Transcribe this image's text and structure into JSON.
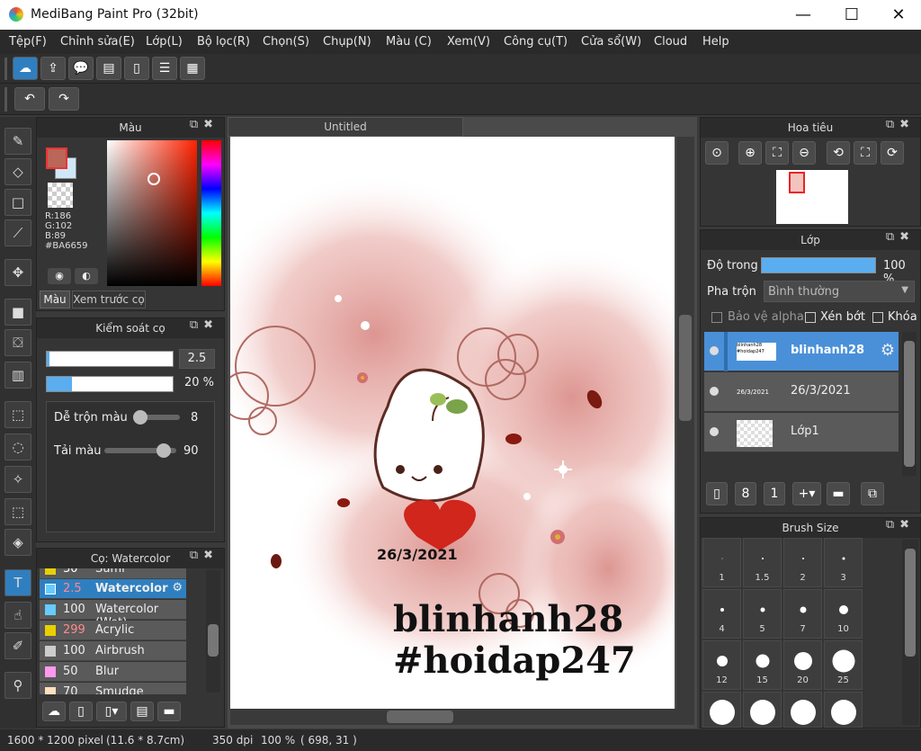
{
  "window": {
    "title": "MediBang Paint Pro (32bit)",
    "min": "—",
    "max": "☐",
    "close": "✕"
  },
  "menu": [
    "Tệp(F)",
    "Chỉnh sửa(E)",
    "Lớp(L)",
    "Bộ lọc(R)",
    "Chọn(S)",
    "Chụp(N)",
    "Màu (C)",
    "Xem(V)",
    "Công cụ(T)",
    "Cửa sổ(W)",
    "Cloud",
    "Help"
  ],
  "color_panel": {
    "title": "Màu",
    "r": "R:186",
    "g": "G:102",
    "b": "B:89",
    "hex": "#BA6659",
    "tab_color": "Màu",
    "tab_preview": "Xem trước cọ",
    "main_color": "#BA6659"
  },
  "brush_control": {
    "title": "Kiểm soát cọ",
    "size": "2.5",
    "opacity": "20 %",
    "mix_label": "Dễ trộn màu",
    "mix_value": "8",
    "load_label": "Tải màu",
    "load_value": "90"
  },
  "brush_list": {
    "title": "Cọ: Watercolor",
    "items": [
      {
        "size": "30",
        "name": "Sumi",
        "color": "#e8d000"
      },
      {
        "size": "2.5",
        "name": "Watercolor",
        "color": "#66ccff"
      },
      {
        "size": "100",
        "name": "Watercolor (Wet)",
        "color": "#66ccff"
      },
      {
        "size": "299",
        "name": "Acrylic",
        "color": "#e8d000"
      },
      {
        "size": "100",
        "name": "Airbrush",
        "color": "#cccccc"
      },
      {
        "size": "50",
        "name": "Blur",
        "color": "#ff99ee"
      },
      {
        "size": "70",
        "name": "Smudge",
        "color": "#ffe0c0"
      }
    ]
  },
  "document": {
    "tab": "Untitled",
    "date_text": "26/3/2021",
    "line1": "blinhanh28",
    "line2": "#hoidap247"
  },
  "navigator": {
    "title": "Hoa tiêu"
  },
  "layer_panel": {
    "title": "Lớp",
    "opacity_label": "Độ trong",
    "opacity_value": "100 %",
    "opacity": 1.0,
    "blend_label": "Pha trộn",
    "blend_value": "Bình thường",
    "protect_alpha": "Bảo vệ alpha",
    "clip": "Xén bớt",
    "lock": "Khóa",
    "layers": [
      {
        "name": "blinhanh28",
        "thumb": "blinhanh28 #hoidap247"
      },
      {
        "name": "26/3/2021",
        "thumb": "26/3/2021"
      },
      {
        "name": "Lớp1",
        "thumb": ""
      }
    ]
  },
  "brush_size_panel": {
    "title": "Brush Size",
    "sizes": [
      "1",
      "1.5",
      "2",
      "3",
      "4",
      "5",
      "7",
      "10",
      "12",
      "15",
      "20",
      "25"
    ]
  },
  "status": {
    "pixels": "1600 * 1200 pixel",
    "cm": "(11.6 * 8.7cm)",
    "dpi": "350 dpi",
    "zoom": "100 %",
    "coords": "( 698, 31 )"
  }
}
